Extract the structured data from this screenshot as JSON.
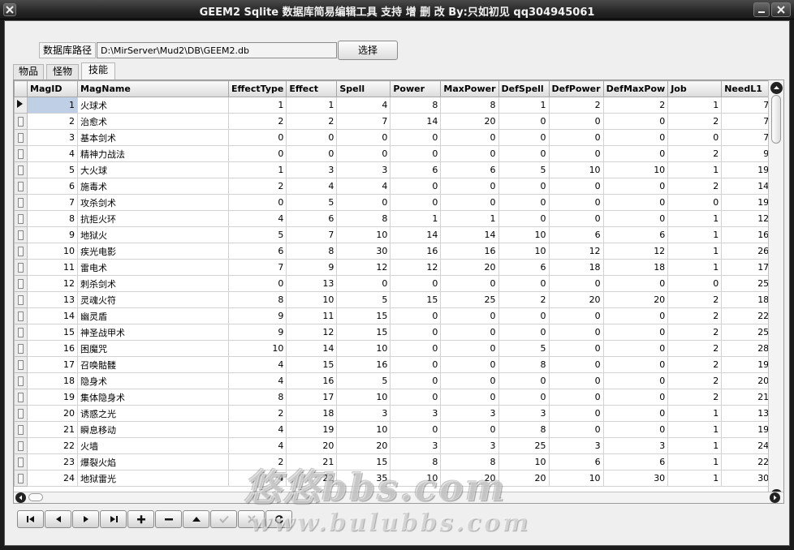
{
  "window": {
    "title": "GEEM2 Sqlite 数据库简易编辑工具 支持 增 删 改 By:只如初见 qq304945061"
  },
  "db": {
    "path_label": "数据库路径",
    "path_value": "D:\\MirServer\\Mud2\\DB\\GEEM2.db",
    "select_label": "选择"
  },
  "tabs": [
    {
      "label": "物品",
      "active": false
    },
    {
      "label": "怪物",
      "active": false
    },
    {
      "label": "技能",
      "active": true
    }
  ],
  "grid": {
    "columns": [
      "MagID",
      "MagName",
      "EffectType",
      "Effect",
      "Spell",
      "Power",
      "MaxPower",
      "DefSpell",
      "DefPower",
      "DefMaxPow",
      "Job",
      "NeedL1"
    ],
    "selected_row": 0,
    "rows": [
      [
        "1",
        "火球术",
        "1",
        "1",
        "4",
        "8",
        "8",
        "1",
        "2",
        "2",
        "1",
        "7"
      ],
      [
        "2",
        "治愈术",
        "2",
        "2",
        "7",
        "14",
        "20",
        "0",
        "0",
        "0",
        "2",
        "7"
      ],
      [
        "3",
        "基本剑术",
        "0",
        "0",
        "0",
        "0",
        "0",
        "0",
        "0",
        "0",
        "0",
        "7"
      ],
      [
        "4",
        "精神力战法",
        "0",
        "0",
        "0",
        "0",
        "0",
        "0",
        "0",
        "0",
        "2",
        "9"
      ],
      [
        "5",
        "大火球",
        "1",
        "3",
        "3",
        "6",
        "6",
        "5",
        "10",
        "10",
        "1",
        "19"
      ],
      [
        "6",
        "施毒术",
        "2",
        "4",
        "4",
        "0",
        "0",
        "0",
        "0",
        "0",
        "2",
        "14"
      ],
      [
        "7",
        "攻杀剑术",
        "0",
        "5",
        "0",
        "0",
        "0",
        "0",
        "0",
        "0",
        "0",
        "19"
      ],
      [
        "8",
        "抗拒火环",
        "4",
        "6",
        "8",
        "1",
        "1",
        "0",
        "0",
        "0",
        "1",
        "12"
      ],
      [
        "9",
        "地狱火",
        "5",
        "7",
        "10",
        "14",
        "14",
        "10",
        "6",
        "6",
        "1",
        "16"
      ],
      [
        "10",
        "疾光电影",
        "6",
        "8",
        "30",
        "16",
        "16",
        "10",
        "12",
        "12",
        "1",
        "26"
      ],
      [
        "11",
        "雷电术",
        "7",
        "9",
        "12",
        "12",
        "20",
        "6",
        "18",
        "18",
        "1",
        "17"
      ],
      [
        "12",
        "刺杀剑术",
        "0",
        "13",
        "0",
        "0",
        "0",
        "0",
        "0",
        "0",
        "0",
        "25"
      ],
      [
        "13",
        "灵魂火符",
        "8",
        "10",
        "5",
        "15",
        "25",
        "2",
        "20",
        "20",
        "2",
        "18"
      ],
      [
        "14",
        "幽灵盾",
        "9",
        "11",
        "15",
        "0",
        "0",
        "0",
        "0",
        "0",
        "2",
        "22"
      ],
      [
        "15",
        "神圣战甲术",
        "9",
        "12",
        "15",
        "0",
        "0",
        "0",
        "0",
        "0",
        "2",
        "25"
      ],
      [
        "16",
        "困魔咒",
        "10",
        "14",
        "10",
        "0",
        "0",
        "5",
        "0",
        "0",
        "2",
        "28"
      ],
      [
        "17",
        "召唤骷髅",
        "4",
        "15",
        "16",
        "0",
        "0",
        "8",
        "0",
        "0",
        "2",
        "19"
      ],
      [
        "18",
        "隐身术",
        "4",
        "16",
        "5",
        "0",
        "0",
        "0",
        "0",
        "0",
        "2",
        "20"
      ],
      [
        "19",
        "集体隐身术",
        "8",
        "17",
        "10",
        "0",
        "0",
        "0",
        "0",
        "0",
        "2",
        "21"
      ],
      [
        "20",
        "诱惑之光",
        "2",
        "18",
        "3",
        "3",
        "3",
        "3",
        "0",
        "0",
        "1",
        "13"
      ],
      [
        "21",
        "瞬息移动",
        "4",
        "19",
        "10",
        "0",
        "0",
        "8",
        "0",
        "0",
        "1",
        "19"
      ],
      [
        "22",
        "火墙",
        "4",
        "20",
        "20",
        "3",
        "3",
        "25",
        "3",
        "3",
        "1",
        "24"
      ],
      [
        "23",
        "爆裂火焰",
        "2",
        "21",
        "15",
        "8",
        "8",
        "10",
        "6",
        "6",
        "1",
        "22"
      ],
      [
        "24",
        "地狱雷光",
        "4",
        "22",
        "35",
        "10",
        "20",
        "20",
        "10",
        "30",
        "1",
        "30"
      ]
    ]
  },
  "navigator": {
    "buttons": [
      {
        "name": "first-record-button",
        "icon": "first-icon",
        "enabled": true
      },
      {
        "name": "prior-record-button",
        "icon": "prior-icon",
        "enabled": true
      },
      {
        "name": "next-record-button",
        "icon": "next-icon",
        "enabled": true
      },
      {
        "name": "last-record-button",
        "icon": "last-icon",
        "enabled": true
      },
      {
        "name": "insert-record-button",
        "icon": "plus-icon",
        "enabled": true
      },
      {
        "name": "delete-record-button",
        "icon": "minus-icon",
        "enabled": true
      },
      {
        "name": "edit-record-button",
        "icon": "up-triangle-icon",
        "enabled": true
      },
      {
        "name": "post-record-button",
        "icon": "check-icon",
        "enabled": false
      },
      {
        "name": "cancel-record-button",
        "icon": "cross-icon",
        "enabled": false
      },
      {
        "name": "refresh-record-button",
        "icon": "refresh-icon",
        "enabled": true
      }
    ]
  },
  "watermark": {
    "line1": "悠悠bbs.com",
    "line2": "www.bulubbs.com"
  }
}
